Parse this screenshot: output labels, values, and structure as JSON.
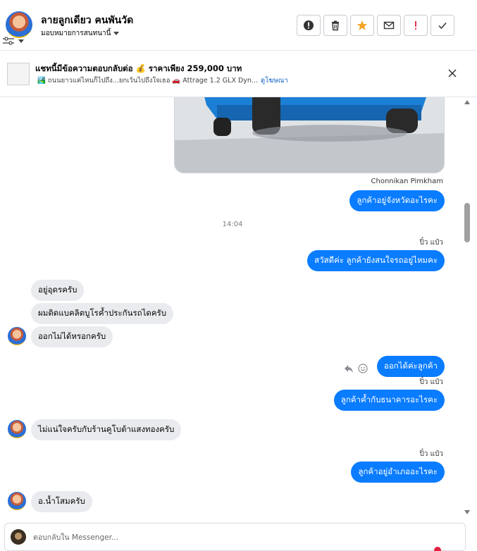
{
  "header": {
    "contact_name": "ลายลูกเดียว คนพันวัด",
    "assign_label": "มอบหมายการสนทนานี้",
    "actions": [
      "alert-circle-icon",
      "trash-icon",
      "star-icon",
      "mail-icon",
      "exclamation-icon",
      "check-icon"
    ],
    "accent_star": "#f5a623",
    "accent_exclaim": "#e41e3f"
  },
  "ad": {
    "title": "แชทนี้มีข้อความตอบกลับต่อ 💰 ราคาเพียง 259,000 บาท",
    "sub_text": "🏞️ ถนนยาวแค่ไหนก็ไปถึง...ยกเว้นไปถึงใจเธอ 🚗 Attrage 1.2 GLX Dyn...",
    "link": "ดูโฆษณา"
  },
  "messages": {
    "sender_top": "Chonnikan Pimkham",
    "m1": "ลูกค้าอยู่จังหวัดอะไรคะ",
    "time": "14:04",
    "sender_2": "ปิ๋ว แป๋ว",
    "m2": "สวัสดีค่ะ ลูกค้ายังสนใจรถอยู่ไหมคะ",
    "in1": "อยู่อุดรครับ",
    "in2": "ผมติดแบคลิตบูโรค้ำประกันรถไดครับ",
    "in3": "ออกไม่ได้หรอกครับ",
    "m3": "ออกได้ค่ะลูกค้า",
    "sender_3": "ปิ๋ว แป๋ว",
    "m4": "ลูกค้าค้ำกับธนาคารอะไรคะ",
    "in4": "ไม่แน่ใจครับกับร้านคูโบต้าแสงทองครับ",
    "sender_4": "ปิ๋ว แป๋ว",
    "m5": "ลูกค้าอยู่อำเภออะไรคะ",
    "in5": "อ.น้ำโสมครับ"
  },
  "composer": {
    "placeholder": "ตอบกลับใน Messenger..."
  },
  "colors": {
    "outgoing": "#0a7cff",
    "incoming": "#e9ebee"
  }
}
